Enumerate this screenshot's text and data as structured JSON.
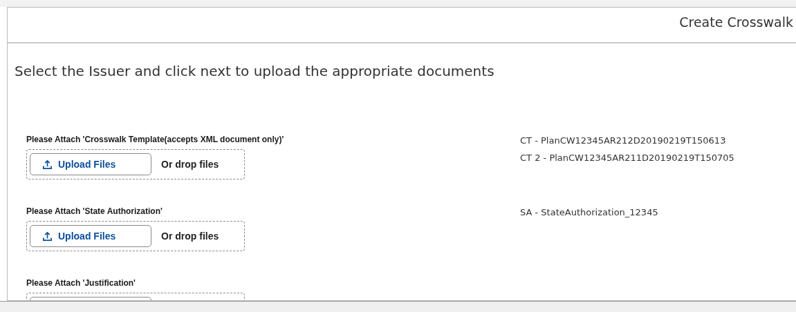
{
  "header": {
    "title": "Create Crosswalk"
  },
  "instruction": "Select the Issuer and click next to upload the appropriate documents",
  "sections": [
    {
      "label": "Please Attach 'Crosswalk Template(accepts XML document only)'",
      "upload": {
        "button": "Upload Files",
        "drop_text": "Or drop files"
      },
      "files": [
        "CT - PlanCW12345AR212D20190219T150613",
        "CT 2 - PlanCW12345AR211D20190219T150705"
      ]
    },
    {
      "label": "Please Attach 'State Authorization'",
      "upload": {
        "button": "Upload Files",
        "drop_text": "Or drop files"
      },
      "files": [
        "SA - StateAuthorization_12345"
      ]
    },
    {
      "label": "Please Attach 'Justification'"
    }
  ]
}
